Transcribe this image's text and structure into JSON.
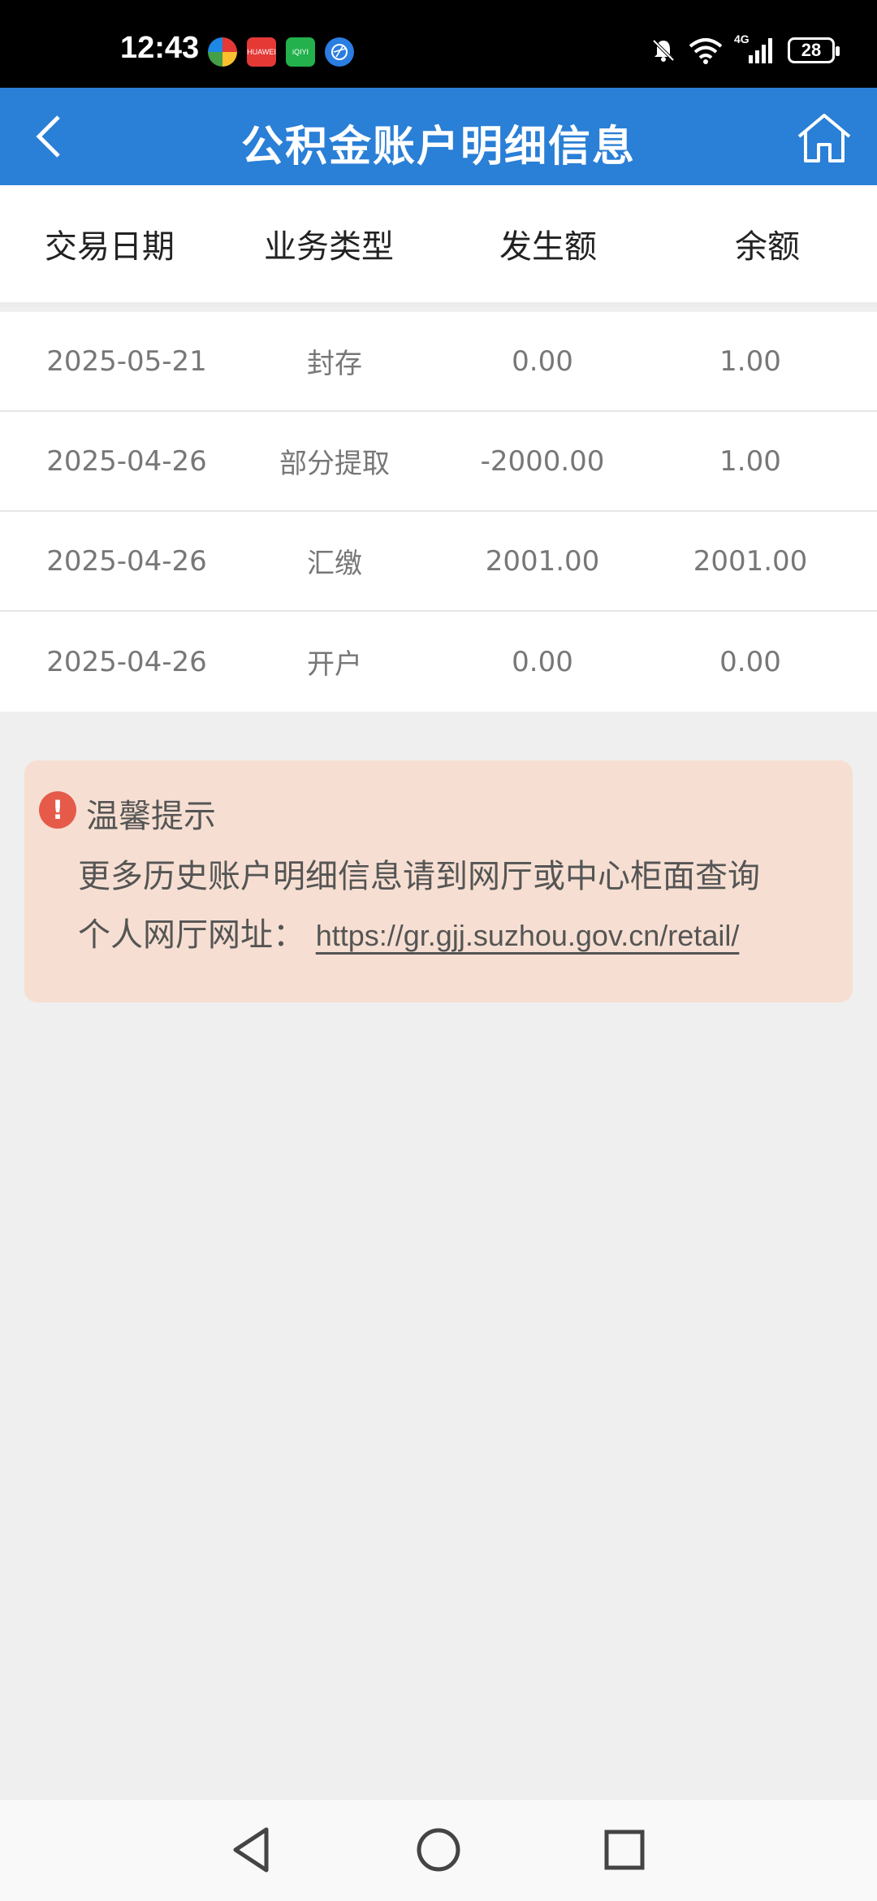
{
  "status_bar": {
    "time": "12:43",
    "network": "4G",
    "battery": "28",
    "app_icons": [
      "colorwheel-icon",
      "huawei-icon",
      "iqiyi-icon",
      "browser-icon"
    ],
    "huawei_label": "HUAWEI",
    "iqiyi_label": "iQIYI"
  },
  "header": {
    "title": "公积金账户明细信息",
    "background": "#2a7fd6"
  },
  "table": {
    "columns": [
      "交易日期",
      "业务类型",
      "发生额",
      "余额"
    ],
    "rows": [
      {
        "date": "2025-05-21",
        "type": "封存",
        "amount": "0.00",
        "balance": "1.00"
      },
      {
        "date": "2025-04-26",
        "type": "部分提取",
        "amount": "-2000.00",
        "balance": "1.00"
      },
      {
        "date": "2025-04-26",
        "type": "汇缴",
        "amount": "2001.00",
        "balance": "2001.00"
      },
      {
        "date": "2025-04-26",
        "type": "开户",
        "amount": "0.00",
        "balance": "0.00"
      }
    ]
  },
  "tips": {
    "icon": "!",
    "title": "温馨提示",
    "line1": "更多历史账户明细信息请到网厅或中心柜面查询",
    "line2_label": "个人网厅网址：",
    "link": "https://gr.gjj.suzhou.gov.cn/retail/",
    "background": "#f6dfd2",
    "icon_color": "#e65a4a"
  }
}
